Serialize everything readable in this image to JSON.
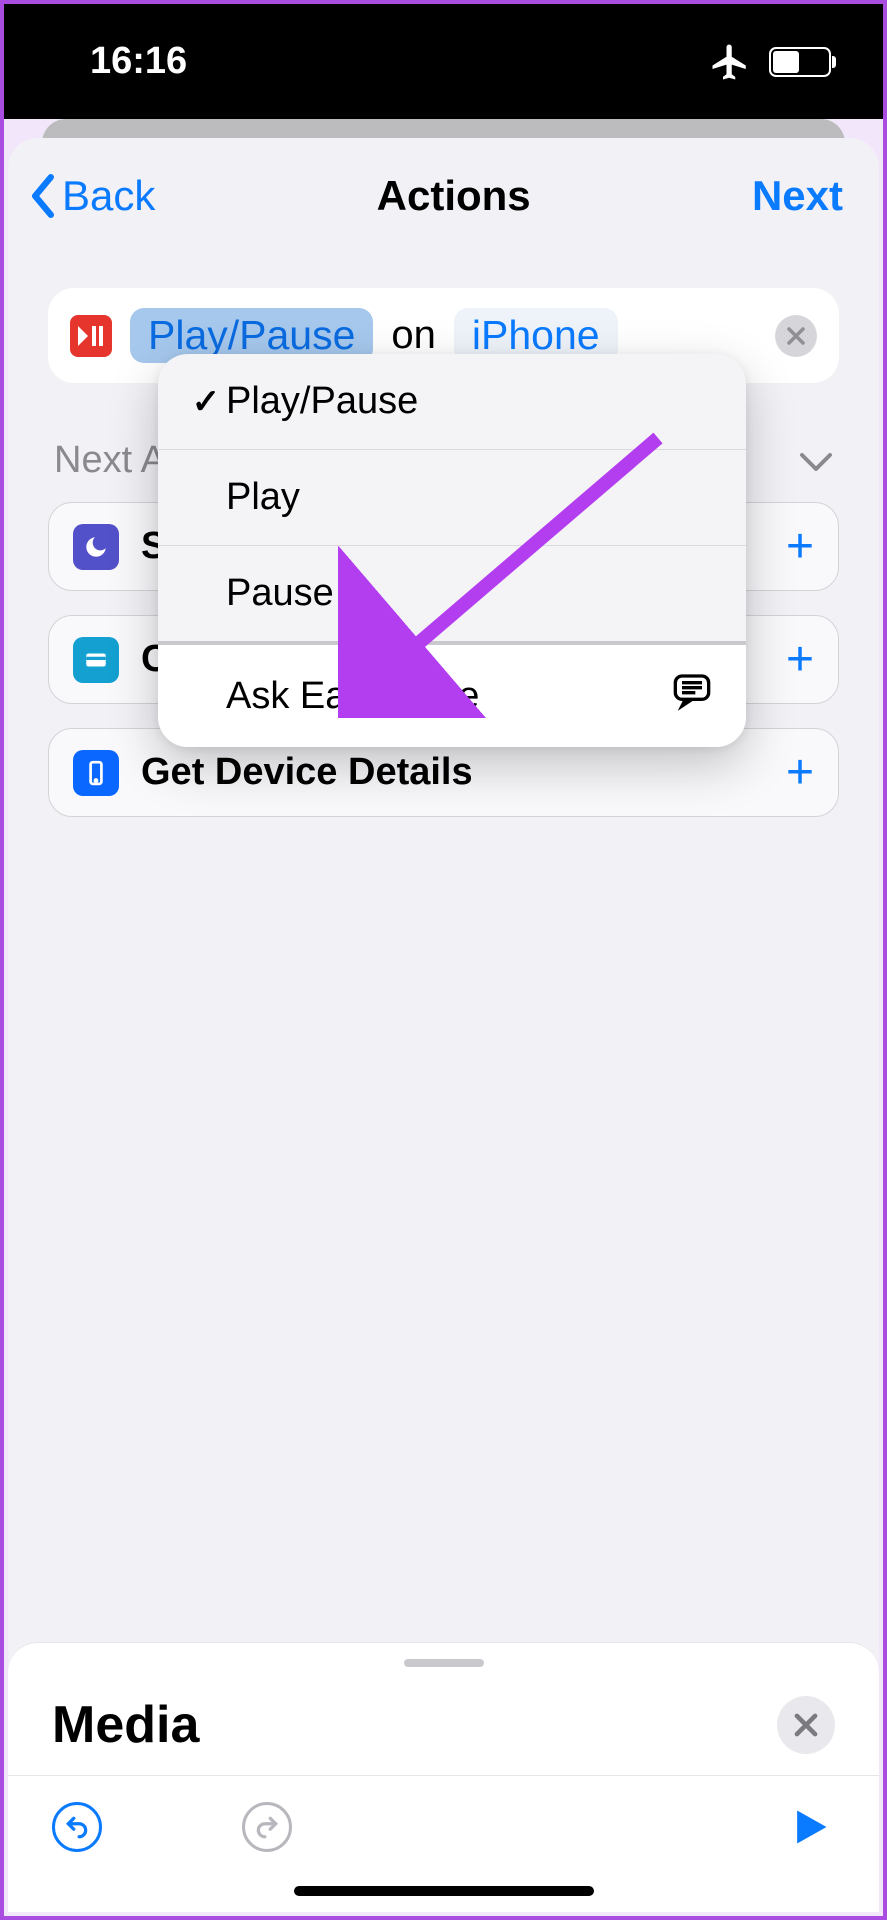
{
  "status": {
    "time": "16:16"
  },
  "nav": {
    "back": "Back",
    "title": "Actions",
    "next": "Next"
  },
  "action": {
    "mode_token": "Play/Pause",
    "joiner": "on",
    "device_token": "iPhone"
  },
  "dropdown": {
    "selected": "Play/Pause",
    "options": [
      "Play/Pause",
      "Play",
      "Pause"
    ],
    "ask": "Ask Each Time"
  },
  "section": {
    "label": "Next Action Suggestions"
  },
  "suggestions": [
    {
      "icon": "moon",
      "label": "Set Focus"
    },
    {
      "icon": "card",
      "label": "Choose"
    },
    {
      "icon": "phone",
      "label": "Get Device Details"
    }
  ],
  "panel": {
    "title": "Media"
  }
}
